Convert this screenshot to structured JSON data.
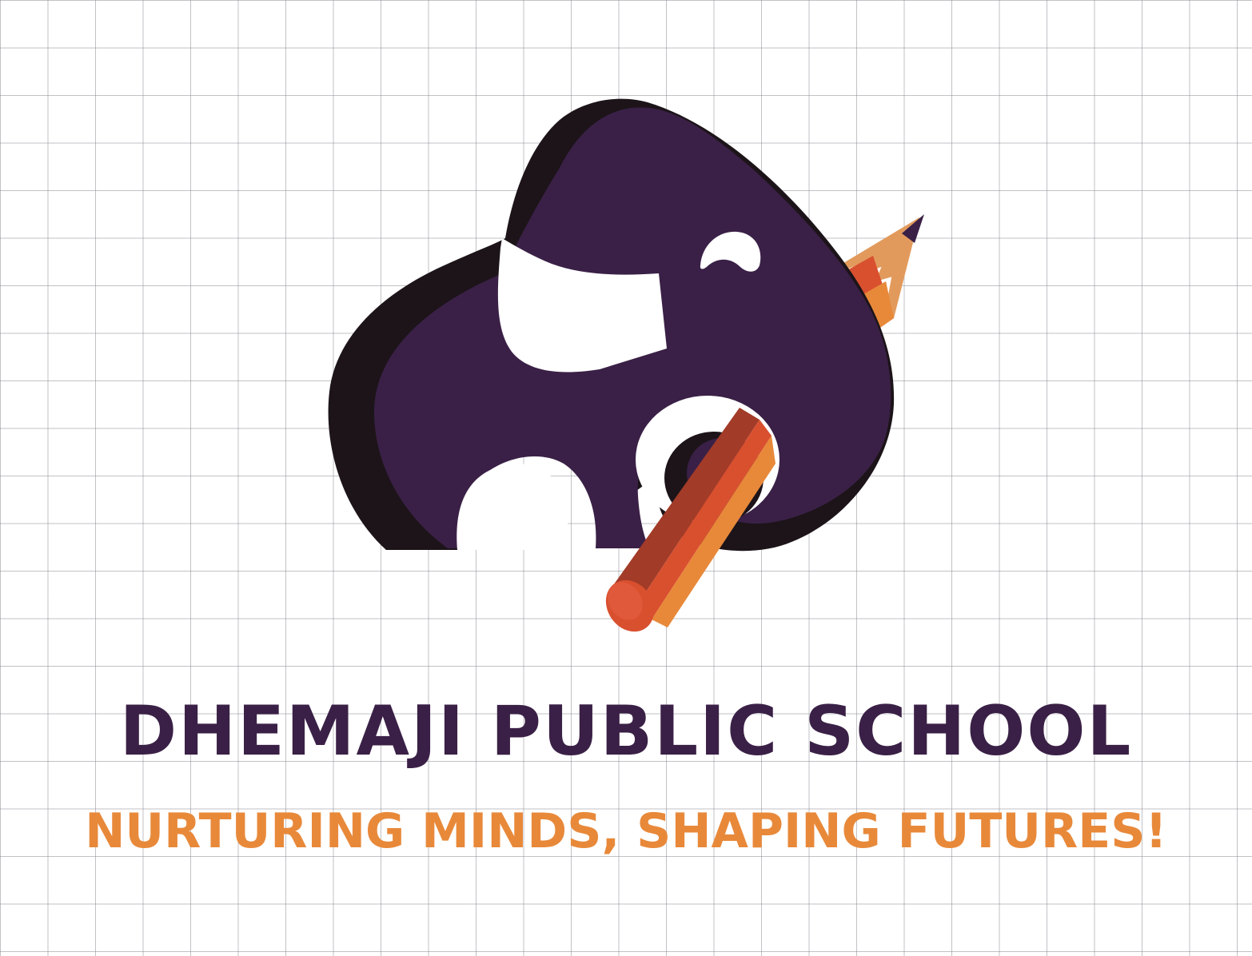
{
  "brand": {
    "name": "DHEMAJI PUBLIC SCHOOL",
    "tagline": "NURTURING MINDS, SHAPING FUTURES!"
  },
  "colors": {
    "primary_purple": "#3a2046",
    "shadow_dark": "#1c1419",
    "accent_orange": "#e8893a",
    "pencil_red": "#d9502f",
    "pencil_dark": "#a23b28",
    "pencil_wood": "#e29a5c",
    "grid_line": "#8a8a92",
    "background": "#ffffff"
  },
  "logo": {
    "mark_icon": "elephant-with-pencil-icon"
  }
}
